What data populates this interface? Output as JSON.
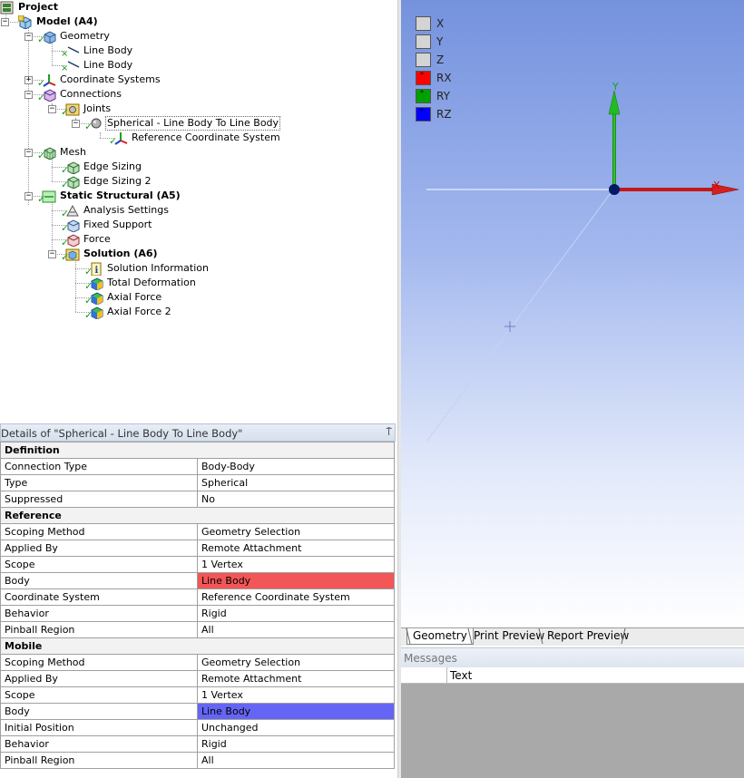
{
  "tree": {
    "nodes": [
      {
        "label": "Project",
        "icon": "project-icon",
        "bold": true
      },
      {
        "label": "Model (A4)",
        "icon": "model-icon",
        "bold": true
      },
      {
        "label": "Geometry",
        "icon": "geometry-icon"
      },
      {
        "label": "Line Body",
        "icon": "line-body-icon"
      },
      {
        "label": "Line Body",
        "icon": "line-body-icon"
      },
      {
        "label": "Coordinate Systems",
        "icon": "coordinate-systems-icon"
      },
      {
        "label": "Connections",
        "icon": "connections-icon"
      },
      {
        "label": "Joints",
        "icon": "joints-icon"
      },
      {
        "label": "Spherical - Line Body To Line Body",
        "icon": "spherical-joint-icon",
        "selected": true
      },
      {
        "label": "Reference Coordinate System",
        "icon": "coordinate-system-icon"
      },
      {
        "label": "Mesh",
        "icon": "mesh-icon"
      },
      {
        "label": "Edge Sizing",
        "icon": "edge-sizing-icon"
      },
      {
        "label": "Edge Sizing 2",
        "icon": "edge-sizing-icon"
      },
      {
        "label": "Static Structural (A5)",
        "icon": "static-structural-icon",
        "bold": true
      },
      {
        "label": "Analysis Settings",
        "icon": "analysis-settings-icon"
      },
      {
        "label": "Fixed Support",
        "icon": "fixed-support-icon"
      },
      {
        "label": "Force",
        "icon": "force-icon"
      },
      {
        "label": "Solution (A6)",
        "icon": "solution-icon",
        "bold": true
      },
      {
        "label": "Solution Information",
        "icon": "solution-information-icon"
      },
      {
        "label": "Total Deformation",
        "icon": "result-icon"
      },
      {
        "label": "Axial Force",
        "icon": "result-icon"
      },
      {
        "label": "Axial Force 2",
        "icon": "result-icon"
      }
    ]
  },
  "details": {
    "title": "Details of \"Spherical - Line Body To Line Body\"",
    "pin_glyph": "⍑",
    "sections": [
      {
        "name": "Definition",
        "rows": [
          [
            "Connection Type",
            "Body-Body"
          ],
          [
            "Type",
            "Spherical"
          ],
          [
            "Suppressed",
            "No"
          ]
        ]
      },
      {
        "name": "Reference",
        "rows": [
          [
            "Scoping Method",
            "Geometry Selection"
          ],
          [
            "Applied By",
            "Remote Attachment"
          ],
          [
            "Scope",
            "1 Vertex"
          ],
          [
            "Body",
            "Line Body"
          ],
          [
            "Coordinate System",
            "Reference Coordinate System"
          ],
          [
            "Behavior",
            "Rigid"
          ],
          [
            "Pinball Region",
            "All"
          ]
        ]
      },
      {
        "name": "Mobile",
        "rows": [
          [
            "Scoping Method",
            "Geometry Selection"
          ],
          [
            "Applied By",
            "Remote Attachment"
          ],
          [
            "Scope",
            "1 Vertex"
          ],
          [
            "Body",
            "Line Body"
          ],
          [
            "Initial Position",
            "Unchanged"
          ],
          [
            "Behavior",
            "Rigid"
          ],
          [
            "Pinball Region",
            "All"
          ]
        ]
      }
    ],
    "highlight_colors": {
      "reference_body": "#f25656",
      "mobile_body": "#6565f5"
    }
  },
  "viewport": {
    "dof_legend": [
      {
        "label": "X",
        "color": "#d4d4d4",
        "mark": ""
      },
      {
        "label": "Y",
        "color": "#d4d4d4",
        "mark": ""
      },
      {
        "label": "Z",
        "color": "#d4d4d4",
        "mark": ""
      },
      {
        "label": "RX",
        "color": "#ff0000",
        "mark": "*"
      },
      {
        "label": "RY",
        "color": "#00a000",
        "mark": "*"
      },
      {
        "label": "RZ",
        "color": "#0000ff",
        "mark": "*"
      }
    ],
    "triad": {
      "x_label": "X",
      "y_label": "Y",
      "x_color": "#d40000",
      "y_color": "#1aa31a",
      "origin_color": "#001a66"
    }
  },
  "tabs": [
    "Geometry",
    "Print Preview",
    "Report Preview"
  ],
  "messages": {
    "title": "Messages",
    "column": "Text"
  }
}
